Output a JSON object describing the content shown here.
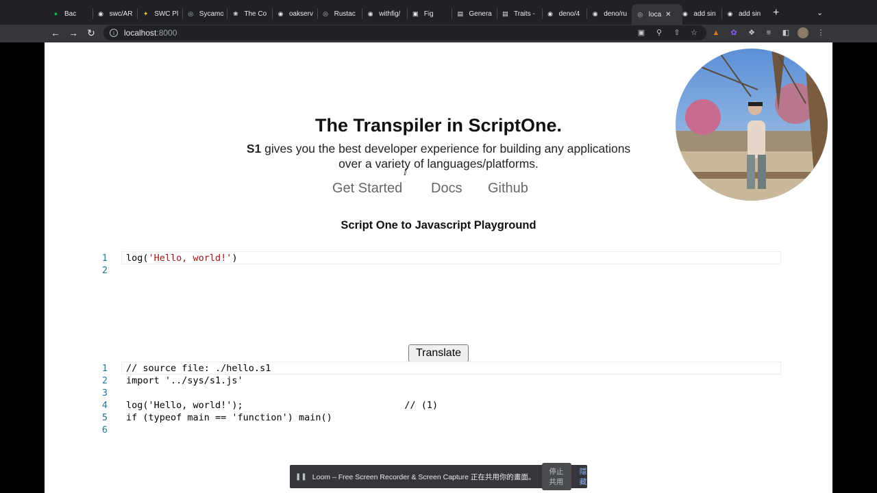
{
  "browser": {
    "tabs": [
      {
        "label": "Bac",
        "icon": "spotify-icon",
        "color": "#1db954"
      },
      {
        "label": "swc/AR",
        "icon": "github-icon",
        "color": "#e8eaed"
      },
      {
        "label": "SWC Pl",
        "icon": "swc-icon",
        "color": "#f7c33b"
      },
      {
        "label": "Sycamo",
        "icon": "globe-icon",
        "color": "#bdc1c6"
      },
      {
        "label": "The Co",
        "icon": "crab-icon",
        "color": "#e8eaed"
      },
      {
        "label": "oakserv",
        "icon": "github-icon",
        "color": "#e8eaed"
      },
      {
        "label": "Rustac",
        "icon": "globe-icon",
        "color": "#bdc1c6"
      },
      {
        "label": "withfig/",
        "icon": "github-icon",
        "color": "#e8eaed"
      },
      {
        "label": "Fig",
        "icon": "fig-icon",
        "color": "#e8eaed"
      },
      {
        "label": "Genera",
        "icon": "book-icon",
        "color": "#e8eaed"
      },
      {
        "label": "Traits -",
        "icon": "book-icon",
        "color": "#e8eaed"
      },
      {
        "label": "deno/4",
        "icon": "github-icon",
        "color": "#e8eaed"
      },
      {
        "label": "deno/ru",
        "icon": "github-icon",
        "color": "#e8eaed"
      },
      {
        "label": "loca",
        "icon": "globe-icon",
        "color": "#bdc1c6"
      },
      {
        "label": "add sin",
        "icon": "github-icon",
        "color": "#e8eaed"
      },
      {
        "label": "add sin",
        "icon": "github-icon",
        "color": "#e8eaed"
      }
    ],
    "url_host": "localhost",
    "url_port": ":8000"
  },
  "page": {
    "title": "The Transpiler in ScriptOne.",
    "subtitle_bold": "S1",
    "subtitle_line1": " gives you the best developer experience for building any applications",
    "subtitle_line2": "over a variety of languages/platforms.",
    "nav": [
      "Get Started",
      "Docs",
      "Github"
    ],
    "playground_title": "Script One to Javascript Playground",
    "translate_label": "Translate"
  },
  "editor_input": {
    "lines": [
      {
        "n": "1",
        "pre": "log(",
        "str": "'Hello, world!'",
        "post": ")"
      },
      {
        "n": "2",
        "pre": "",
        "str": "",
        "post": ""
      }
    ]
  },
  "editor_output": {
    "lines": [
      {
        "n": "1",
        "text": "// source file: ./hello.s1"
      },
      {
        "n": "2",
        "text": "import '../sys/s1.js'"
      },
      {
        "n": "3",
        "text": ""
      },
      {
        "n": "4",
        "text": "log('Hello, world!');                             // (1)"
      },
      {
        "n": "5",
        "text": "if (typeof main == 'function') main()"
      },
      {
        "n": "6",
        "text": ""
      }
    ]
  },
  "loom": {
    "message": "Loom – Free Screen Recorder & Screen Capture 正在共用你的畫面。",
    "stop_label": "停止共用",
    "hide_label": "隱藏"
  }
}
